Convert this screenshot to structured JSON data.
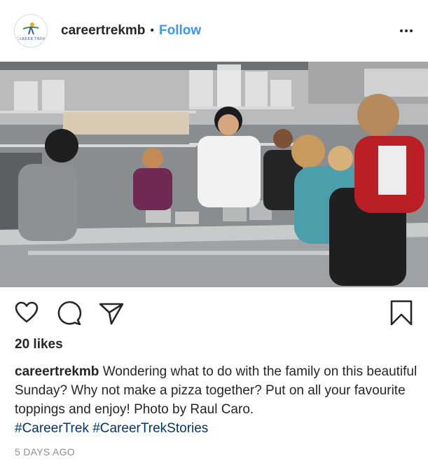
{
  "post": {
    "username": "careertrekmb",
    "separator": "•",
    "follow_label": "Follow",
    "avatar_text": "CAREER TREK",
    "photo_alt": "",
    "likes": "20 likes",
    "caption": {
      "username": "careertrekmb",
      "text": "Wondering what to do with the family on this beautiful Sunday? Why not make a pizza together? Put on all your favourite toppings and enjoy! Photo by Raul Caro.",
      "hashtags": [
        "#CareerTrek",
        "#CareerTrekStories"
      ]
    },
    "timestamp": "5 DAYS AGO"
  },
  "icons": {
    "more": "more-options-icon",
    "like": "heart-icon",
    "comment": "comment-bubble-icon",
    "share": "paper-plane-icon",
    "save": "bookmark-icon"
  },
  "colors": {
    "link_blue": "#3897f0",
    "hashtag_blue": "#003569",
    "text": "#262626",
    "muted": "#8e8e8e"
  }
}
